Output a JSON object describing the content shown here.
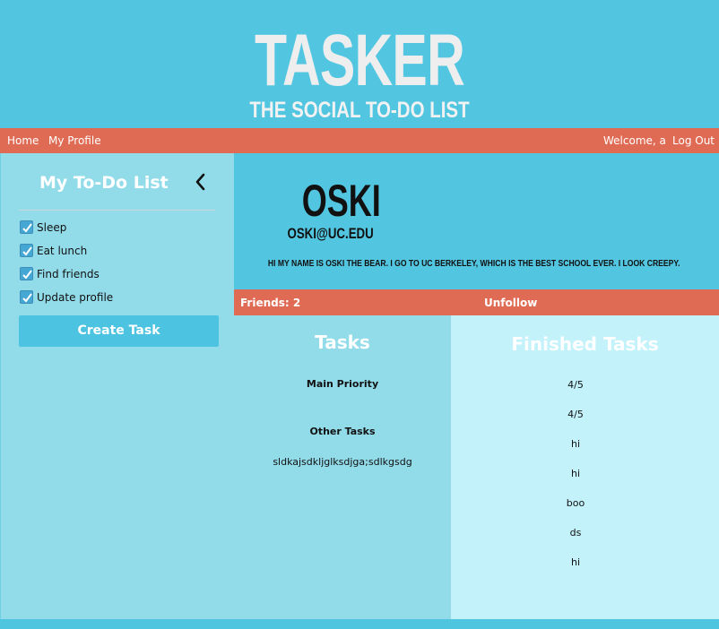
{
  "header": {
    "logo": "TASKER",
    "tagline": "THE SOCIAL TO-DO LIST"
  },
  "nav": {
    "home": "Home",
    "my_profile": "My Profile",
    "welcome": "Welcome, a",
    "logout": "Log Out"
  },
  "sidebar": {
    "title": "My To-Do List",
    "tasks": [
      {
        "label": "Sleep",
        "checked": true
      },
      {
        "label": "Eat lunch",
        "checked": true
      },
      {
        "label": "Find friends",
        "checked": true
      },
      {
        "label": "Update profile",
        "checked": true
      }
    ],
    "create_button": "Create Task"
  },
  "profile": {
    "name": "OSKI",
    "email": "OSKI@UC.EDU",
    "bio": "HI MY NAME IS OSKI THE BEAR. I GO TO UC BERKELEY, WHICH IS THE BEST SCHOOL EVER. I LOOK CREEPY."
  },
  "friends_bar": {
    "friends": "Friends: 2",
    "unfollow": "Unfollow"
  },
  "tasks_panel": {
    "title": "Tasks",
    "main_priority_heading": "Main Priority",
    "other_tasks_heading": "Other Tasks",
    "other_tasks": [
      "sldkajsdkljglksdjga;sdlkgsdg"
    ]
  },
  "finished_panel": {
    "title": "Finished Tasks",
    "items": [
      "4/5",
      "4/5",
      "hi",
      "hi",
      "boo",
      "ds",
      "hi"
    ]
  },
  "colors": {
    "header_blue": "#52c6e1",
    "nav_coral": "#e06b55",
    "sidebar_blue": "#92dcea",
    "finished_light_blue": "#c3f2fb",
    "checkbox_blue": "#45a7d3"
  }
}
